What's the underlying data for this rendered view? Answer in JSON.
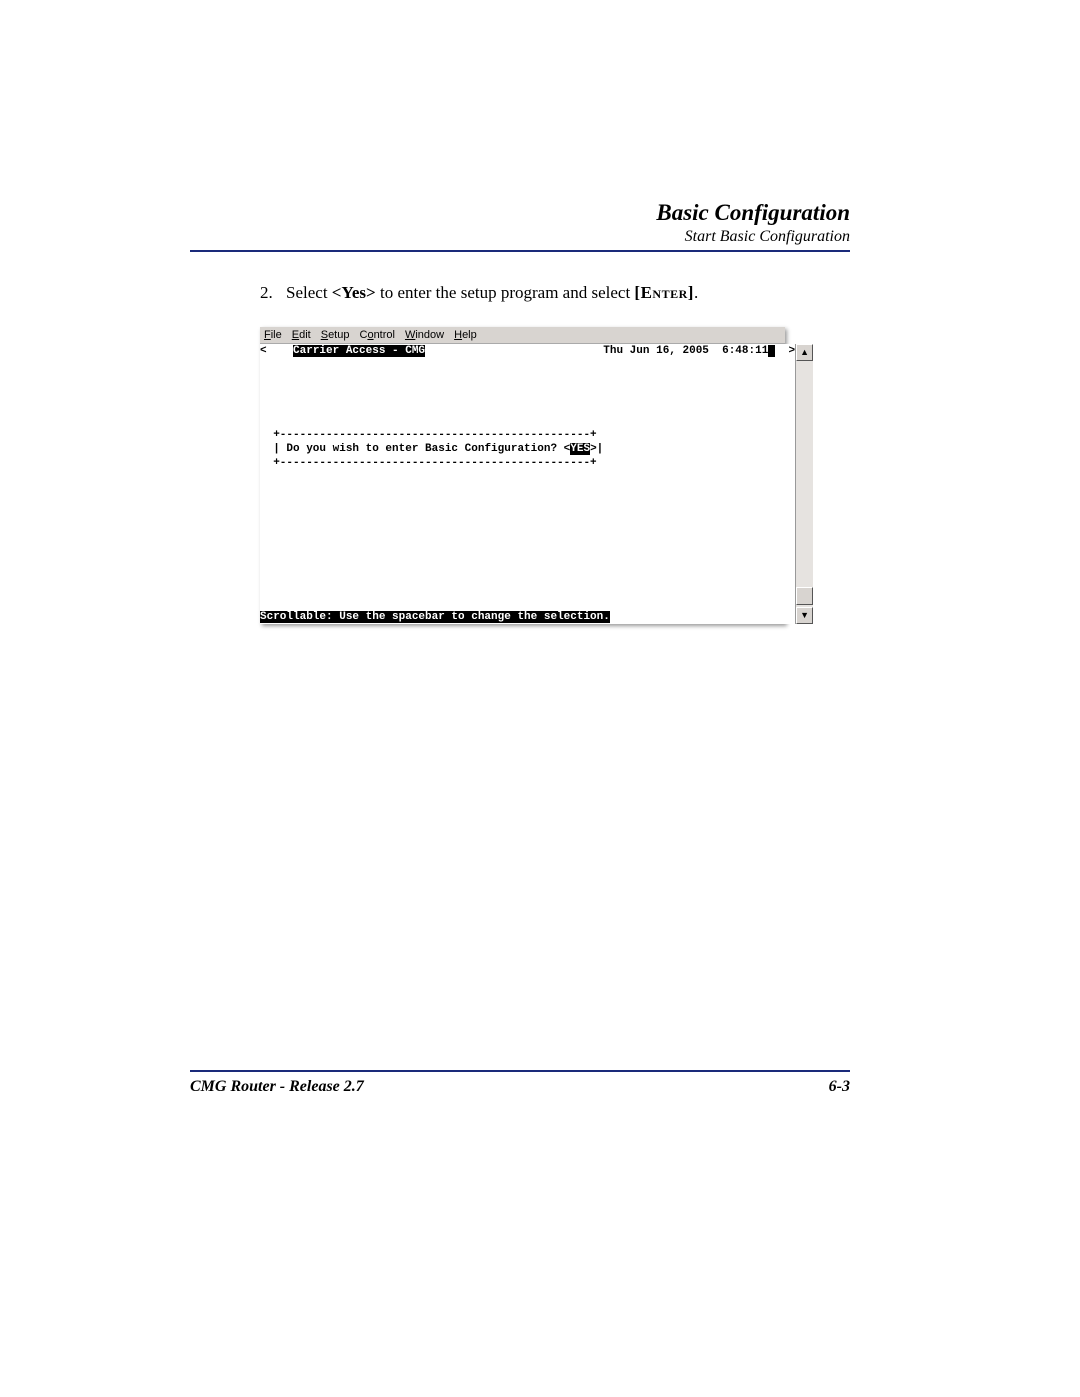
{
  "header": {
    "title": "Basic Configuration",
    "subtitle": "Start Basic Configuration"
  },
  "step": {
    "number": "2.",
    "pre": "Select ",
    "yes": "<Yes>",
    "mid": " to enter the setup program and select ",
    "enter": "[Enter]",
    "post": "."
  },
  "menubar": {
    "file": "File",
    "edit": "Edit",
    "setup": "Setup",
    "control": "Control",
    "window": "Window",
    "help": "Help"
  },
  "terminal": {
    "lt": "<",
    "app_title": "Carrier Access - CMG",
    "timestamp": "Thu Jun 16, 2005  6:48:11",
    "gt": ">",
    "box_top": "  +-----------------------------------------------+",
    "box_left": "  | ",
    "prompt": "Do you wish to enter Basic Configuration? <",
    "choice": "YES",
    "box_right": ">|",
    "box_bot": "  +-----------------------------------------------+",
    "status": "Scrollable: Use the spacebar to change the selection."
  },
  "icons": {
    "up": "▲",
    "down": "▼"
  },
  "footer": {
    "left": "CMG Router - Release 2.7",
    "right": "6-3"
  }
}
